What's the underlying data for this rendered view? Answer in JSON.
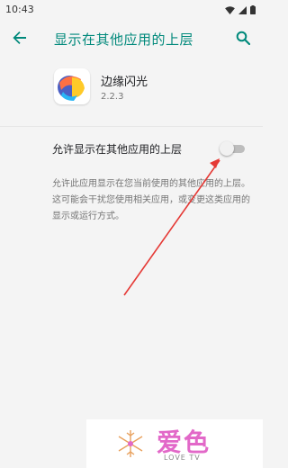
{
  "status_bar": {
    "time": "10:43",
    "icons": [
      "wifi-icon",
      "signal-icon",
      "battery-icon"
    ]
  },
  "app_bar": {
    "title": "显示在其他应用的上层",
    "back_icon": "arrow-back-icon",
    "search_icon": "search-icon"
  },
  "app": {
    "name": "边缘闪光",
    "version": "2.2.3"
  },
  "setting": {
    "label": "允许显示在其他应用的上层",
    "enabled": false
  },
  "description": "允许此应用显示在您当前使用的其他应用的上层。这可能会干扰您使用相关应用，或变更这类应用的显示或运行方式。",
  "watermark": {
    "text_cn": "爱色",
    "text_en": "LOVE TV"
  },
  "colors": {
    "accent": "#00897b",
    "annotation_arrow": "#e53935",
    "watermark": "#e268c8"
  }
}
